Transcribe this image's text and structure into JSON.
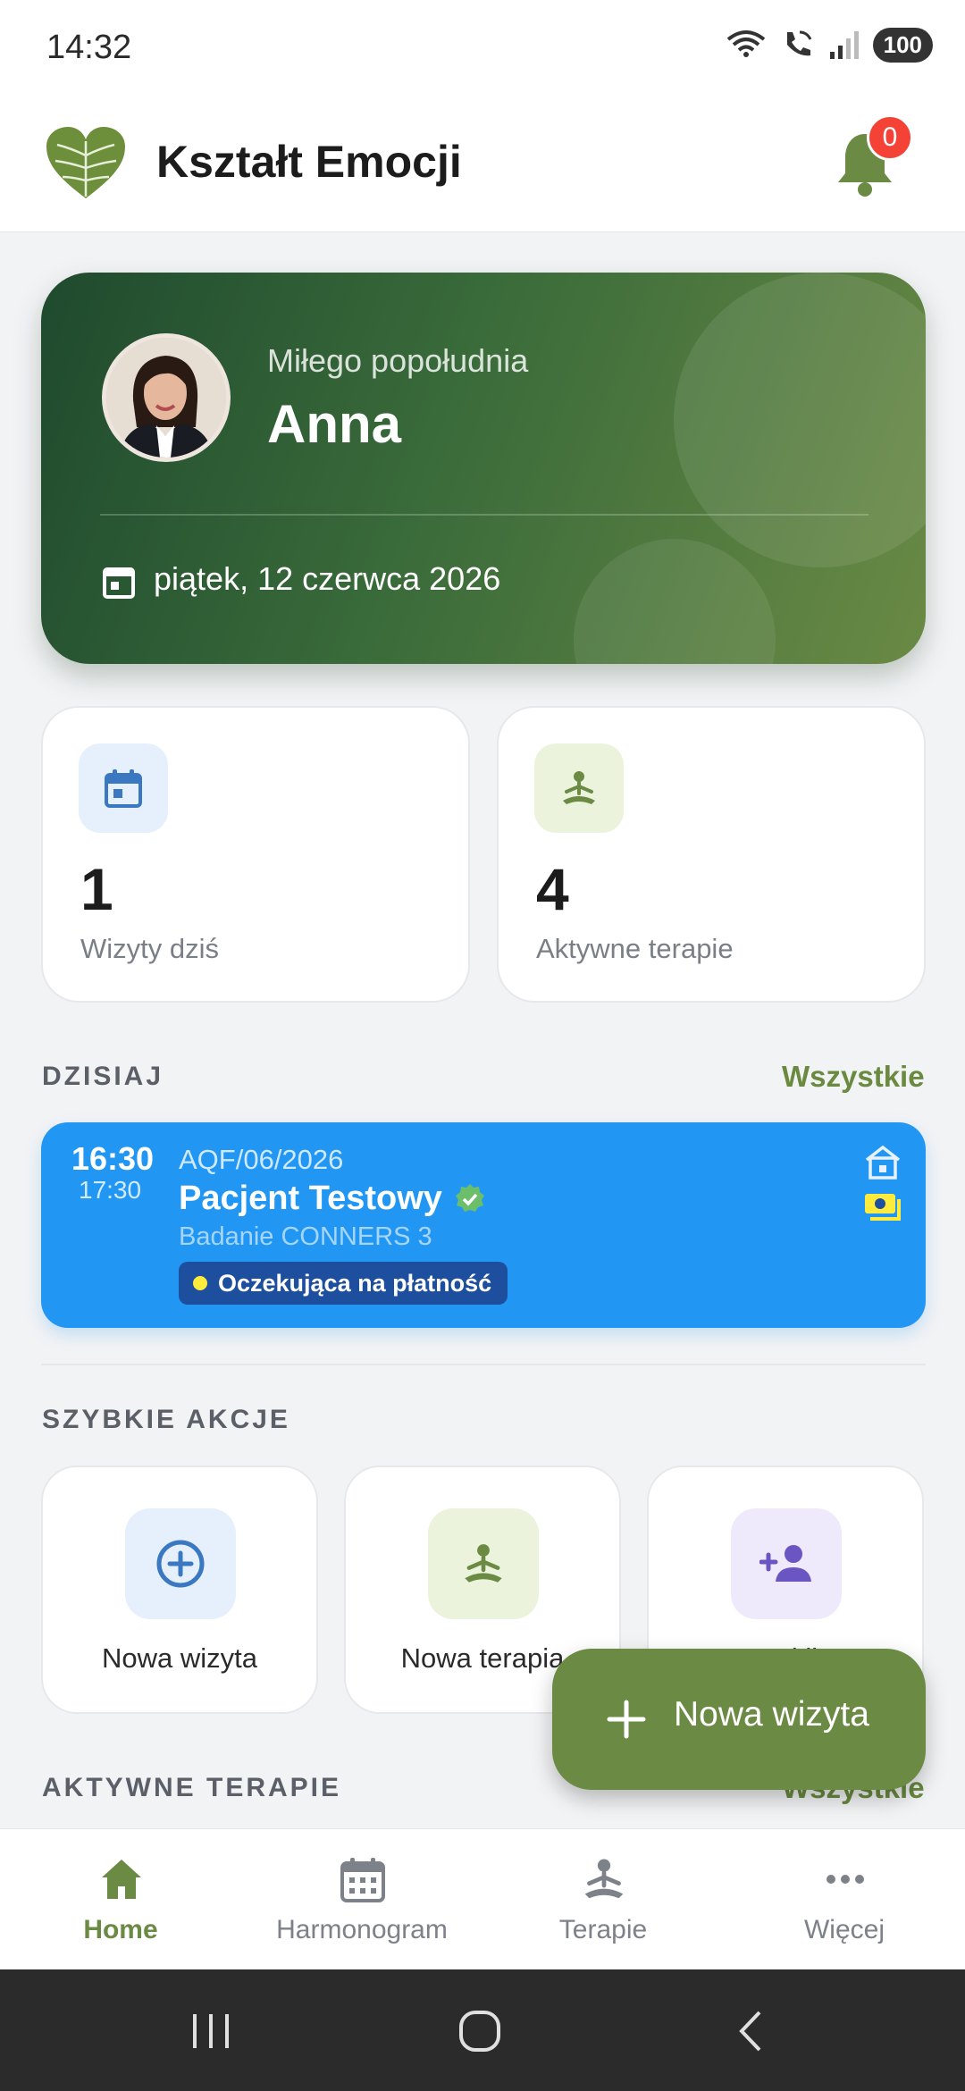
{
  "status_bar": {
    "time": "14:32",
    "battery": "100"
  },
  "header": {
    "title": "Kształt Emocji",
    "notification_count": "0"
  },
  "hero": {
    "greeting": "Miłego popołudnia",
    "name": "Anna",
    "date": "piątek, 12 czerwca 2026"
  },
  "stats": [
    {
      "value": "1",
      "label": "Wizyty dziś"
    },
    {
      "value": "4",
      "label": "Aktywne terapie"
    }
  ],
  "today": {
    "title": "DZISIAJ",
    "link": "Wszystkie",
    "appointment": {
      "start": "16:30",
      "end": "17:30",
      "code": "AQF/06/2026",
      "patient": "Pacjent Testowy",
      "service": "Badanie CONNERS 3",
      "status": "Oczekująca na płatność"
    }
  },
  "quick_actions": {
    "title": "SZYBKIE AKCJE",
    "items": [
      {
        "label": "Nowa wizyta",
        "icon": "plus-circle-icon"
      },
      {
        "label": "Nowa terapia",
        "icon": "meditation-icon"
      },
      {
        "label": "Nowy klient",
        "icon": "add-person-icon"
      }
    ]
  },
  "active_therapies": {
    "title": "AKTYWNE TERAPIE",
    "link": "Wszystkie"
  },
  "fab": {
    "label": "Nowa wizyta"
  },
  "bottom_nav": [
    {
      "label": "Home",
      "icon": "home-icon",
      "active": true
    },
    {
      "label": "Harmonogram",
      "icon": "calendar-icon",
      "active": false
    },
    {
      "label": "Terapie",
      "icon": "meditation-icon",
      "active": false
    },
    {
      "label": "Więcej",
      "icon": "more-icon",
      "active": false
    }
  ],
  "colors": {
    "accent": "#6b8a43",
    "appointment": "#2196f3",
    "badge": "#f44336"
  }
}
